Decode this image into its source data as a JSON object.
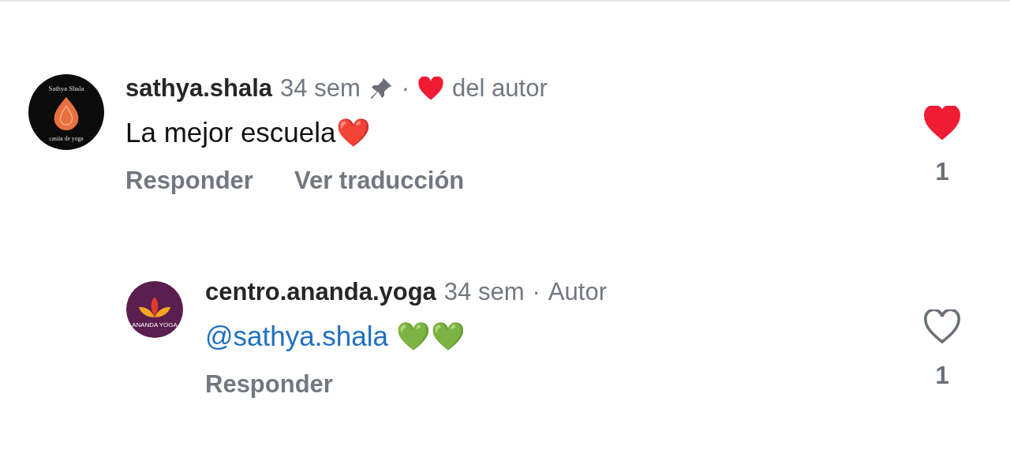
{
  "comments": [
    {
      "avatar": {
        "kind": "sathya",
        "top_text": "Sathya Shala",
        "bottom_text": "casita de yoga"
      },
      "username": "sathya.shala",
      "time": "34 sem",
      "pinned": true,
      "separator": "·",
      "author_liked": true,
      "author_label": "del autor",
      "text": "La mejor escuela❤️",
      "actions": [
        "Responder",
        "Ver traducción"
      ],
      "liked": true,
      "likes": "1",
      "replies": [
        {
          "avatar": {
            "kind": "ananda",
            "bottom_text": "ANANDA YOGA"
          },
          "username": "centro.ananda.yoga",
          "time": "34 sem",
          "pinned": false,
          "separator": "·",
          "author_liked": false,
          "author_label": "Autor",
          "mention": "@sathya.shala",
          "text": "💚💚",
          "actions": [
            "Responder"
          ],
          "liked": false,
          "likes": "1"
        }
      ]
    }
  ]
}
